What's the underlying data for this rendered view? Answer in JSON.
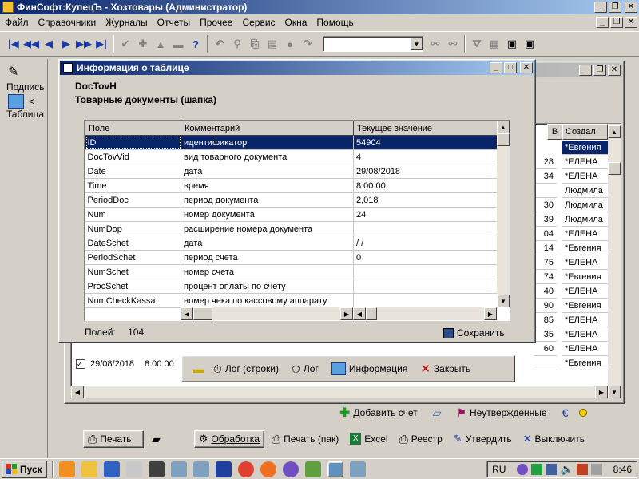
{
  "app": {
    "title": "ФинСофт:КупецЪ - Хозтовары  (Администратор)",
    "menu": [
      "Файл",
      "Справочники",
      "Журналы",
      "Отчеты",
      "Прочее",
      "Сервис",
      "Окна",
      "Помощь"
    ]
  },
  "left_panel": {
    "podpis": "Подпись",
    "table": "Таблица",
    "arrow": "<"
  },
  "back_window": {
    "columns": {
      "v": "В",
      "created": "Создал"
    },
    "numcol": [
      "28",
      "34",
      "",
      "30",
      "39",
      "04",
      "14",
      "75",
      "74",
      "40",
      "90",
      "85",
      "35",
      "60",
      ""
    ],
    "creators": [
      "*Евгения",
      "*ЕЛЕНА",
      "*ЕЛЕНА",
      "Людмила",
      "Людмила",
      "Людмила",
      "*ЕЛЕНА",
      "*Евгения",
      "*ЕЛЕНА",
      "*Евгения",
      "*ЕЛЕНА",
      "*Евгения",
      "*ЕЛЕНА",
      "*ЕЛЕНА",
      "*ЕЛЕНА",
      "*Евгения"
    ],
    "bottom_row": {
      "date": "29/08/2018",
      "time": "8:00:00"
    },
    "action_bar": {
      "log_rows": "Лог (строки)",
      "log": "Лог",
      "info": "Информация",
      "close": "Закрыть"
    },
    "buttons2": {
      "add_invoice": "Добавить счет",
      "unconfirmed": "Неутвержденные"
    },
    "bottom_toolbar": {
      "print": "Печать",
      "processing": "Обработка",
      "print_pack": "Печать (пак)",
      "excel": "Excel",
      "registry": "Реестр",
      "approve": "Утвердить",
      "exit": "Выключить"
    }
  },
  "dialog": {
    "title": "Информация о таблице",
    "table_name": "DocTovH",
    "table_desc": "Товарные документы (шапка)",
    "columns": [
      "Поле",
      "Комментарий",
      "Текущее значение"
    ],
    "rows": [
      [
        "ID",
        "идентификатор",
        "54904"
      ],
      [
        "DocTovVid",
        "вид товарного документа",
        "4"
      ],
      [
        "Date",
        "дата",
        "29/08/2018"
      ],
      [
        "Time",
        "время",
        "8:00:00"
      ],
      [
        "PeriodDoc",
        "период документа",
        "2,018"
      ],
      [
        "Num",
        "номер документа",
        "24"
      ],
      [
        "NumDop",
        "расширение номера документа",
        ""
      ],
      [
        "DateSchet",
        "дата",
        " /  /"
      ],
      [
        "PeriodSchet",
        "период счета",
        "0"
      ],
      [
        "NumSchet",
        "номер счета",
        ""
      ],
      [
        "ProcSchet",
        "процент оплаты по счету",
        ""
      ],
      [
        "NumCheckKassa",
        "номер чека по кассовому аппарату",
        ""
      ]
    ],
    "fields_label": "Полей:",
    "fields_count": "104",
    "save_label": "Сохранить"
  },
  "taskbar": {
    "start": "Пуск",
    "lang": "RU",
    "clock": "8:46"
  },
  "colors": {
    "title_active": "#0a246a",
    "title_gradient_end": "#a6caf0",
    "selection": "#0a246a",
    "face": "#d4d0c8",
    "desktop_task": "#d4d0c8"
  }
}
